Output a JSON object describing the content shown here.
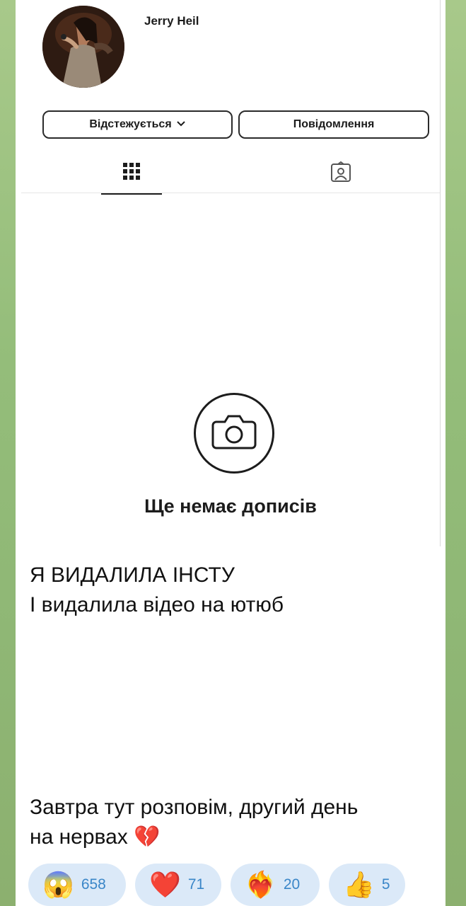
{
  "profile": {
    "username": "Jerry Heil",
    "follow_button": "Відстежується",
    "message_button": "Повідомлення",
    "empty_title": "Ще немає дописів"
  },
  "post": {
    "line1": "Я ВИДАЛИЛА ІНСТУ",
    "line2": "І видалила відео на ютюб",
    "line3": "Завтра тут розповім, другий день",
    "line4": "на нервах 💔"
  },
  "reactions": [
    {
      "emoji": "😱",
      "count": "658"
    },
    {
      "emoji": "❤️",
      "count": "71"
    },
    {
      "emoji": "❤️‍🔥",
      "count": "20"
    },
    {
      "emoji": "👍",
      "count": "5"
    }
  ],
  "colors": {
    "background_green": "#94bd7a",
    "reaction_bg": "#dbe9f8",
    "reaction_text": "#3a86c8"
  }
}
